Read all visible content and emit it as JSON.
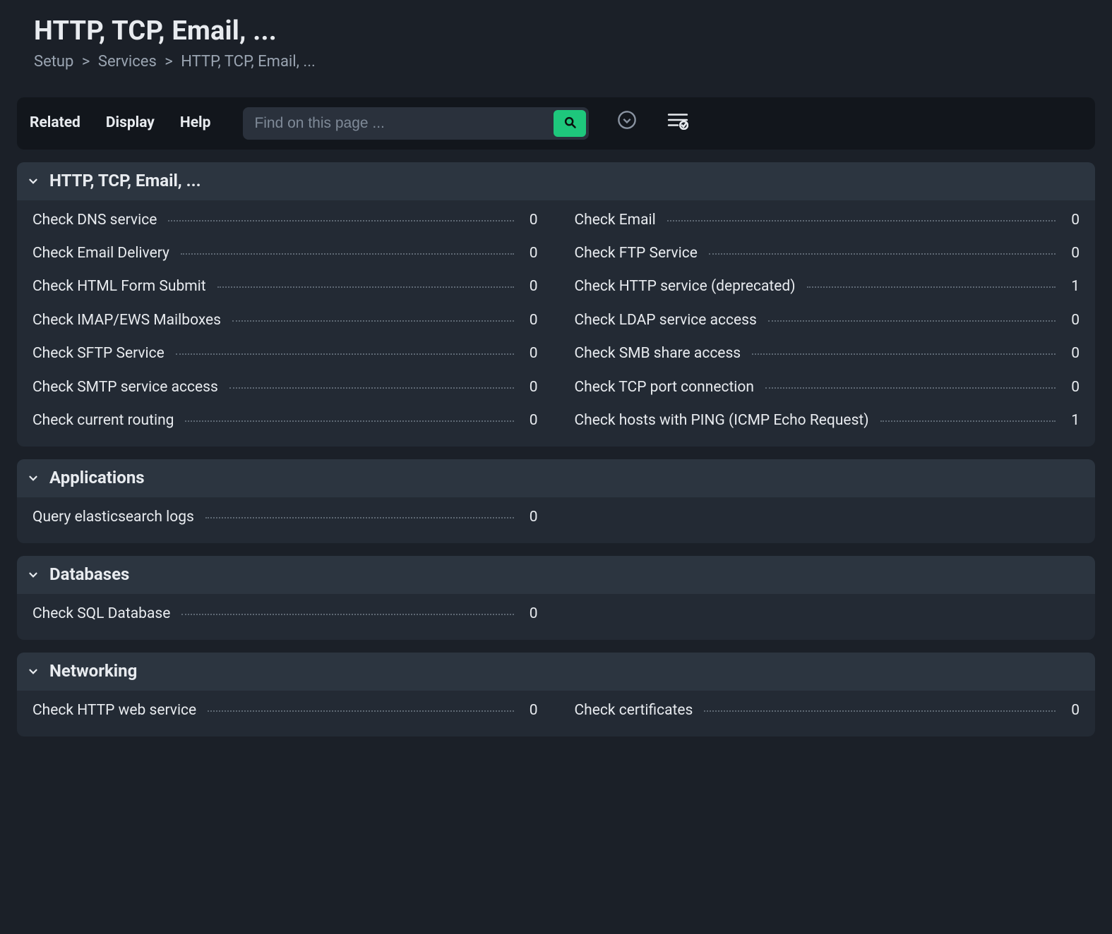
{
  "header": {
    "title": "HTTP, TCP, Email, ...",
    "breadcrumb": {
      "setup": "Setup",
      "services": "Services",
      "current": "HTTP, TCP, Email, ..."
    }
  },
  "toolbar": {
    "related": "Related",
    "display": "Display",
    "help": "Help",
    "search_placeholder": "Find on this page ..."
  },
  "sections": [
    {
      "id": "http",
      "title": "HTTP, TCP, Email, ...",
      "rows": [
        {
          "label": "Check DNS service",
          "count": 0
        },
        {
          "label": "Check Email",
          "count": 0
        },
        {
          "label": "Check Email Delivery",
          "count": 0
        },
        {
          "label": "Check FTP Service",
          "count": 0
        },
        {
          "label": "Check HTML Form Submit",
          "count": 0
        },
        {
          "label": "Check HTTP service (deprecated)",
          "count": 1
        },
        {
          "label": "Check IMAP/EWS Mailboxes",
          "count": 0
        },
        {
          "label": "Check LDAP service access",
          "count": 0
        },
        {
          "label": "Check SFTP Service",
          "count": 0
        },
        {
          "label": "Check SMB share access",
          "count": 0
        },
        {
          "label": "Check SMTP service access",
          "count": 0
        },
        {
          "label": "Check TCP port connection",
          "count": 0
        },
        {
          "label": "Check current routing",
          "count": 0
        },
        {
          "label": "Check hosts with PING (ICMP Echo Request)",
          "count": 1
        }
      ]
    },
    {
      "id": "applications",
      "title": "Applications",
      "rows": [
        {
          "label": "Query elasticsearch logs",
          "count": 0
        }
      ]
    },
    {
      "id": "databases",
      "title": "Databases",
      "rows": [
        {
          "label": "Check SQL Database",
          "count": 0
        }
      ]
    },
    {
      "id": "networking",
      "title": "Networking",
      "rows": [
        {
          "label": "Check HTTP web service",
          "count": 0
        },
        {
          "label": "Check certificates",
          "count": 0
        }
      ]
    }
  ]
}
